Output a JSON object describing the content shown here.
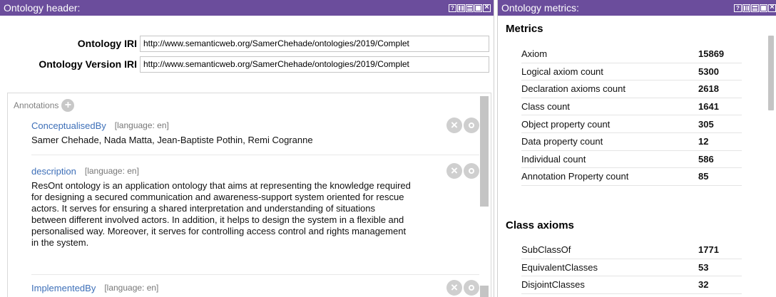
{
  "left_panel": {
    "title": "Ontology header:",
    "ontology_iri": {
      "label": "Ontology IRI",
      "value": "http://www.semanticweb.org/SamerChehade/ontologies/2019/Complet"
    },
    "ontology_version_iri": {
      "label": "Ontology Version IRI",
      "value": "http://www.semanticweb.org/SamerChehade/ontologies/2019/Complet"
    },
    "annotations_label": "Annotations",
    "annotations": [
      {
        "property": "ConceptualisedBy",
        "lang": "[language: en]",
        "lines": [
          "Samer Chehade, Nada Matta, Jean-Baptiste Pothin, Remi Cogranne"
        ]
      },
      {
        "property": "description",
        "lang": "[language: en]",
        "lines": [
          "ResOnt ontology is an application ontology that aims at representing the knowledge required",
          "for designing a secured communication and awareness-support system oriented for rescue",
          "actors. It serves for ensuring a shared interpretation and understanding of situations",
          "between different involved actors. In addition, it helps to design the system in a flexible and",
          "personalised way. Moreover, it serves for controlling access control and rights management",
          "in the system."
        ]
      },
      {
        "property": "ImplementedBy",
        "lang": "[language: en]",
        "lines": []
      }
    ]
  },
  "right_panel": {
    "title": "Ontology metrics:",
    "metrics_title": "Metrics",
    "metrics": [
      {
        "name": "Axiom",
        "value": "15869"
      },
      {
        "name": "Logical axiom count",
        "value": "5300"
      },
      {
        "name": "Declaration axioms count",
        "value": "2618"
      },
      {
        "name": "Class count",
        "value": "1641"
      },
      {
        "name": "Object property count",
        "value": "305"
      },
      {
        "name": "Data property count",
        "value": "12"
      },
      {
        "name": "Individual count",
        "value": "586"
      },
      {
        "name": "Annotation Property count",
        "value": "85"
      }
    ],
    "class_axioms_title": "Class axioms",
    "class_axioms": [
      {
        "name": "SubClassOf",
        "value": "1771"
      },
      {
        "name": "EquivalentClasses",
        "value": "53"
      },
      {
        "name": "DisjointClasses",
        "value": "32"
      }
    ]
  },
  "window_buttons": [
    "help-icon",
    "split-vertical-icon",
    "split-horizontal-icon",
    "maximize-icon",
    "close-icon"
  ],
  "window_button_glyph": "?",
  "colors": {
    "titlebar": "#6b4d9c",
    "link": "#3d6fb8"
  }
}
